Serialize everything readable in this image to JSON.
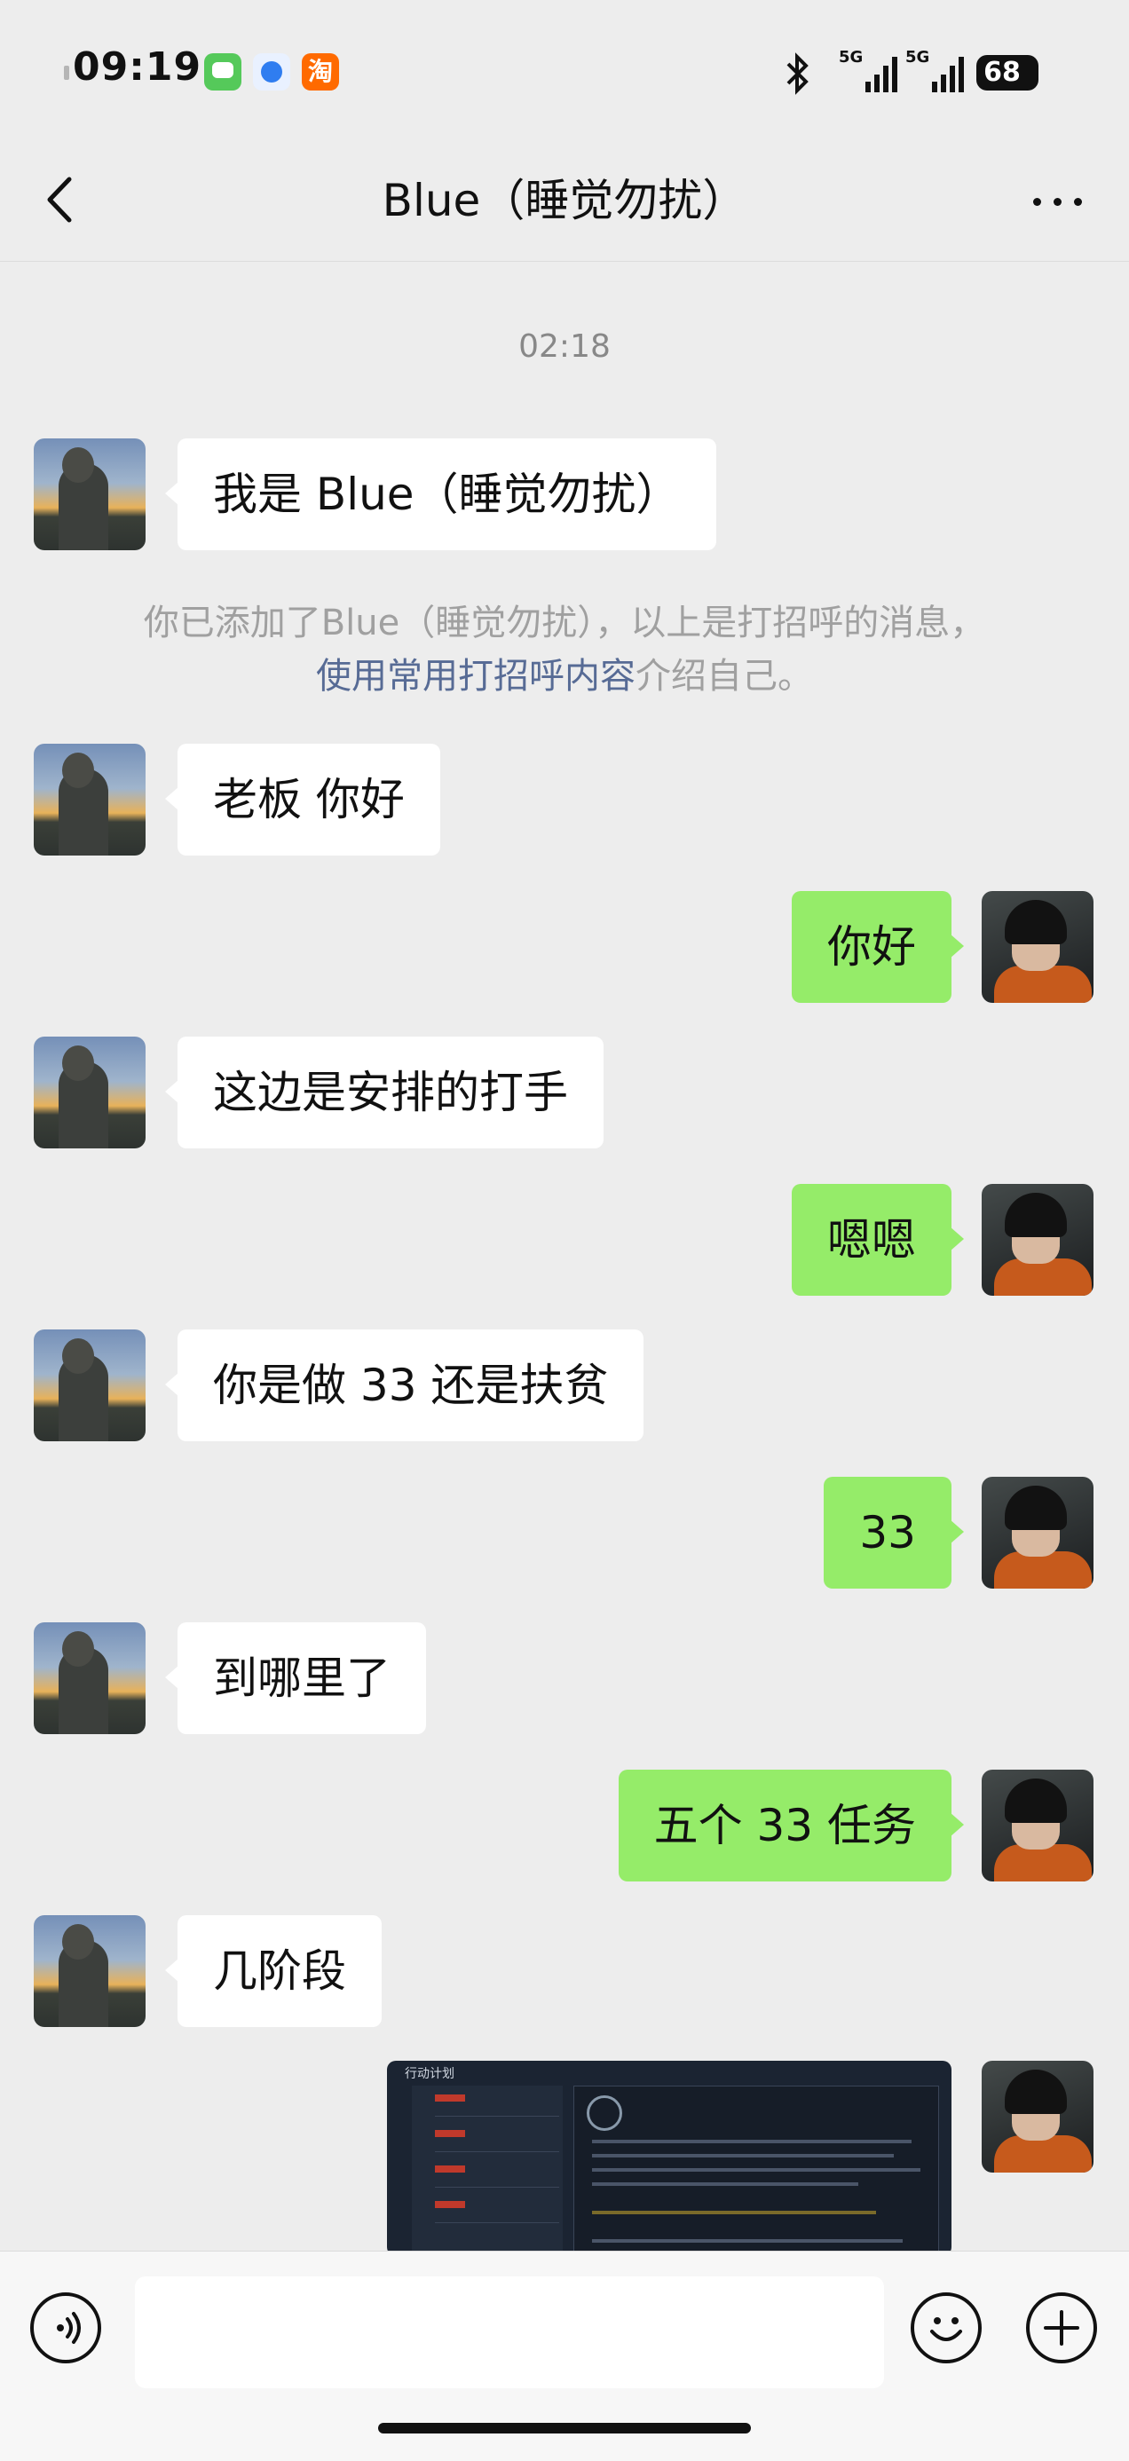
{
  "status_bar": {
    "time": "09:19",
    "battery": "68",
    "signal1": "5G",
    "signal2": "5G",
    "taobao_label": "淘"
  },
  "header": {
    "title": "Blue（睡觉勿扰）"
  },
  "chat": {
    "timestamp": "02:18",
    "greeting": "我是 Blue（睡觉勿扰）",
    "system_note": {
      "line1": "你已添加了Blue（睡觉勿扰），以上是打招呼的消息，",
      "link": "使用常用打招呼内容",
      "line2_suffix": "介绍自己。"
    },
    "messages": [
      {
        "side": "left",
        "text": "老板 你好"
      },
      {
        "side": "right",
        "text": "你好"
      },
      {
        "side": "left",
        "text": "这边是安排的打手"
      },
      {
        "side": "right",
        "text": "嗯嗯"
      },
      {
        "side": "left",
        "text": "你是做 33 还是扶贫"
      },
      {
        "side": "right",
        "text": "33"
      },
      {
        "side": "left",
        "text": "到哪里了"
      },
      {
        "side": "right",
        "text": "五个 33 任务"
      },
      {
        "side": "left",
        "text": "几阶段"
      }
    ],
    "image_header": "行动计划"
  }
}
